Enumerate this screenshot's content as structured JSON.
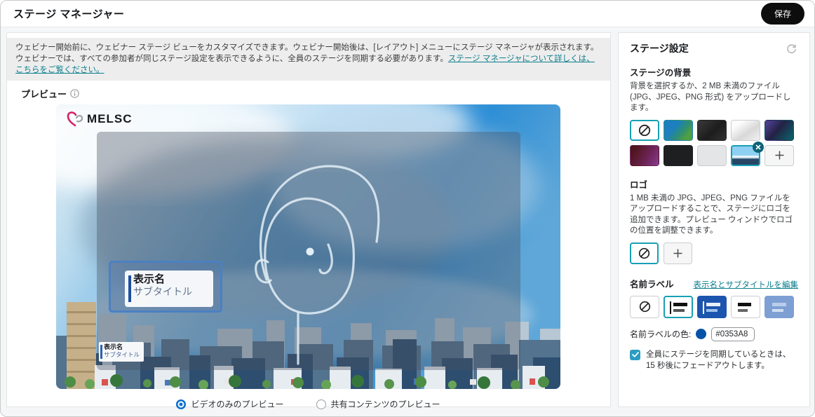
{
  "page": {
    "title": "ステージ マネージャー",
    "save_label": "保存"
  },
  "banner": {
    "line1": "ウェビナー開始前に、ウェビナー ステージ ビューをカスタマイズできます。ウェビナー開始後は、[レイアウト] メニューにステージ マネージャが表示されます。",
    "line2": "ウェビナーでは、すべての参加者が同じステージ設定を表示できるように、全員のステージを同期する必要があります。",
    "link": "ステージ マネージャについて詳しくは、こちらをご覧ください。"
  },
  "preview": {
    "label": "プレビュー",
    "logo_text": "MELSC",
    "name_label": {
      "display_name": "表示名",
      "subtitle": "サブタイトル"
    },
    "radios": [
      {
        "label": "ビデオのみのプレビュー",
        "selected": true
      },
      {
        "label": "共有コンテンツのプレビュー",
        "selected": false
      }
    ]
  },
  "settings": {
    "title": "ステージ設定",
    "background": {
      "heading": "ステージの背景",
      "description": "背景を選択するか、2 MB 未満のファイル (JPG、JPEG、PNG 形式) をアップロードします。",
      "options": [
        "none",
        "blue-green-gradient",
        "dark-wave",
        "light-silk",
        "purple-teal-gradient",
        "red-purple-gradient",
        "black",
        "light-gray",
        "city-photo",
        "upload"
      ],
      "selected": "city-photo"
    },
    "logo": {
      "heading": "ロゴ",
      "description": "1 MB 未満の JPG、JPEG、PNG ファイルをアップロードすることで、ステージにロゴを追加できます。プレビュー ウィンドウでロゴの位置を調整できます。",
      "options": [
        "none",
        "upload"
      ],
      "selected": "none"
    },
    "name_label": {
      "heading": "名前ラベル",
      "edit_link": "表示名とサブタイトルを編集",
      "styles": [
        "none",
        "light-left-bar",
        "filled-dark-blue",
        "light-plain",
        "filled-steel-blue"
      ],
      "selected_style": "light-left-bar",
      "color_label": "名前ラベルの色:",
      "color_value": "#0353A8",
      "sync_checkbox": "全員にステージを同期しているときは、15 秒後にフェードアウトします。",
      "sync_checked": true
    }
  },
  "icons": {
    "refresh": "circular-arrow",
    "info": "circled-i",
    "none": "prohibition-circle",
    "add": "plus",
    "remove": "x-in-teal-circle"
  },
  "colors": {
    "accent_teal": "#17A0B5",
    "link_teal": "#0A7E8C",
    "name_label_color": "#0353A8",
    "radio_blue": "#0E6FD1",
    "checkbox_blue": "#2D9CC3",
    "save_button_bg": "#0D0D0D"
  }
}
